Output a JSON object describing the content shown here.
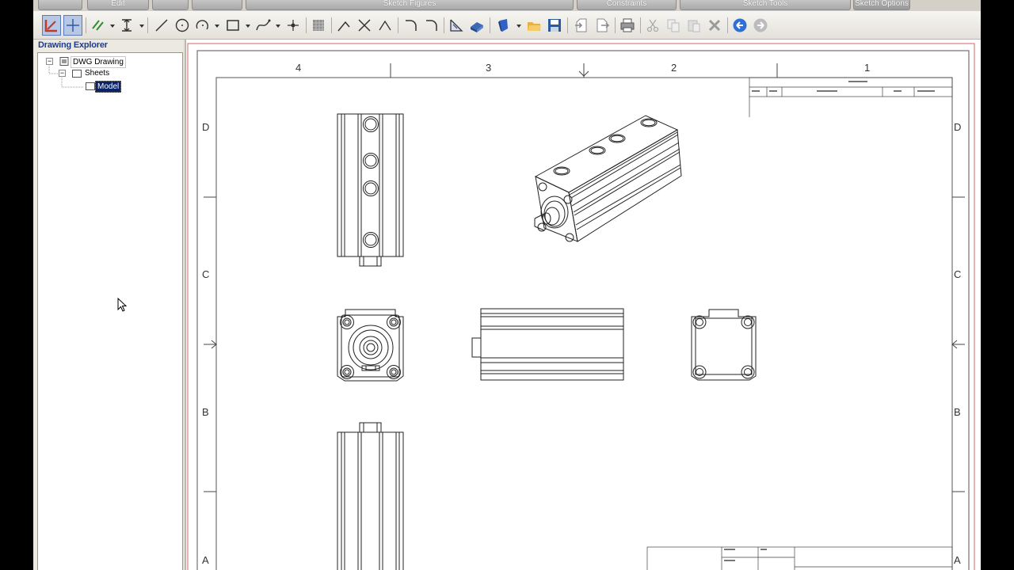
{
  "tab_groups": [
    "Edit",
    "Sketch Figures",
    "Constraints",
    "Sketch Tools",
    "Sketch Options"
  ],
  "toolbar": {
    "buttons": [
      {
        "name": "select-tool",
        "icon": "select-arrow-icon",
        "pressed": true
      },
      {
        "name": "snap-tool",
        "icon": "crosshair-icon",
        "pressed": true
      },
      {
        "name": "parallel-constraint",
        "icon": "parallel-lines-icon"
      },
      {
        "name": "dimension-tool",
        "icon": "dimension-icon"
      },
      {
        "name": "line-tool",
        "icon": "line-icon"
      },
      {
        "name": "circle-tool",
        "icon": "circle-icon"
      },
      {
        "name": "arc-tool",
        "icon": "arc-icon"
      },
      {
        "name": "rectangle-tool",
        "icon": "rectangle-icon"
      },
      {
        "name": "spline-tool",
        "icon": "spline-icon"
      },
      {
        "name": "point-tool",
        "icon": "point-icon"
      },
      {
        "name": "hatch-tool",
        "icon": "hatch-icon"
      },
      {
        "name": "trim-tool",
        "icon": "trim-icon"
      },
      {
        "name": "extend-tool",
        "icon": "extend-icon"
      },
      {
        "name": "fillet-tool",
        "icon": "fillet-icon"
      },
      {
        "name": "chamfer-tool",
        "icon": "chamfer-icon"
      },
      {
        "name": "view-tool",
        "icon": "view-icon"
      },
      {
        "name": "part-view-tool",
        "icon": "part-view-icon"
      },
      {
        "name": "shield-tool",
        "icon": "shield-icon"
      },
      {
        "name": "open-file",
        "icon": "folder-open-icon"
      },
      {
        "name": "save-file",
        "icon": "save-icon"
      },
      {
        "name": "import",
        "icon": "import-icon"
      },
      {
        "name": "export",
        "icon": "export-icon"
      },
      {
        "name": "print",
        "icon": "printer-icon"
      },
      {
        "name": "cut",
        "icon": "scissors-icon"
      },
      {
        "name": "copy",
        "icon": "copy-icon"
      },
      {
        "name": "paste",
        "icon": "paste-icon"
      },
      {
        "name": "delete",
        "icon": "delete-x-icon"
      },
      {
        "name": "undo",
        "icon": "undo-icon"
      },
      {
        "name": "redo",
        "icon": "redo-icon"
      }
    ]
  },
  "explorer": {
    "title": "Drawing Explorer",
    "root": "DWG Drawing",
    "sheets": "Sheets",
    "model": "Model"
  },
  "sheet": {
    "columns": [
      "4",
      "3",
      "2",
      "1"
    ],
    "rows": [
      "D",
      "C",
      "B",
      "A"
    ]
  },
  "colors": {
    "selection": "#0a246a",
    "title_text": "#1e3c8c",
    "sheet_border": "#cc6666"
  }
}
